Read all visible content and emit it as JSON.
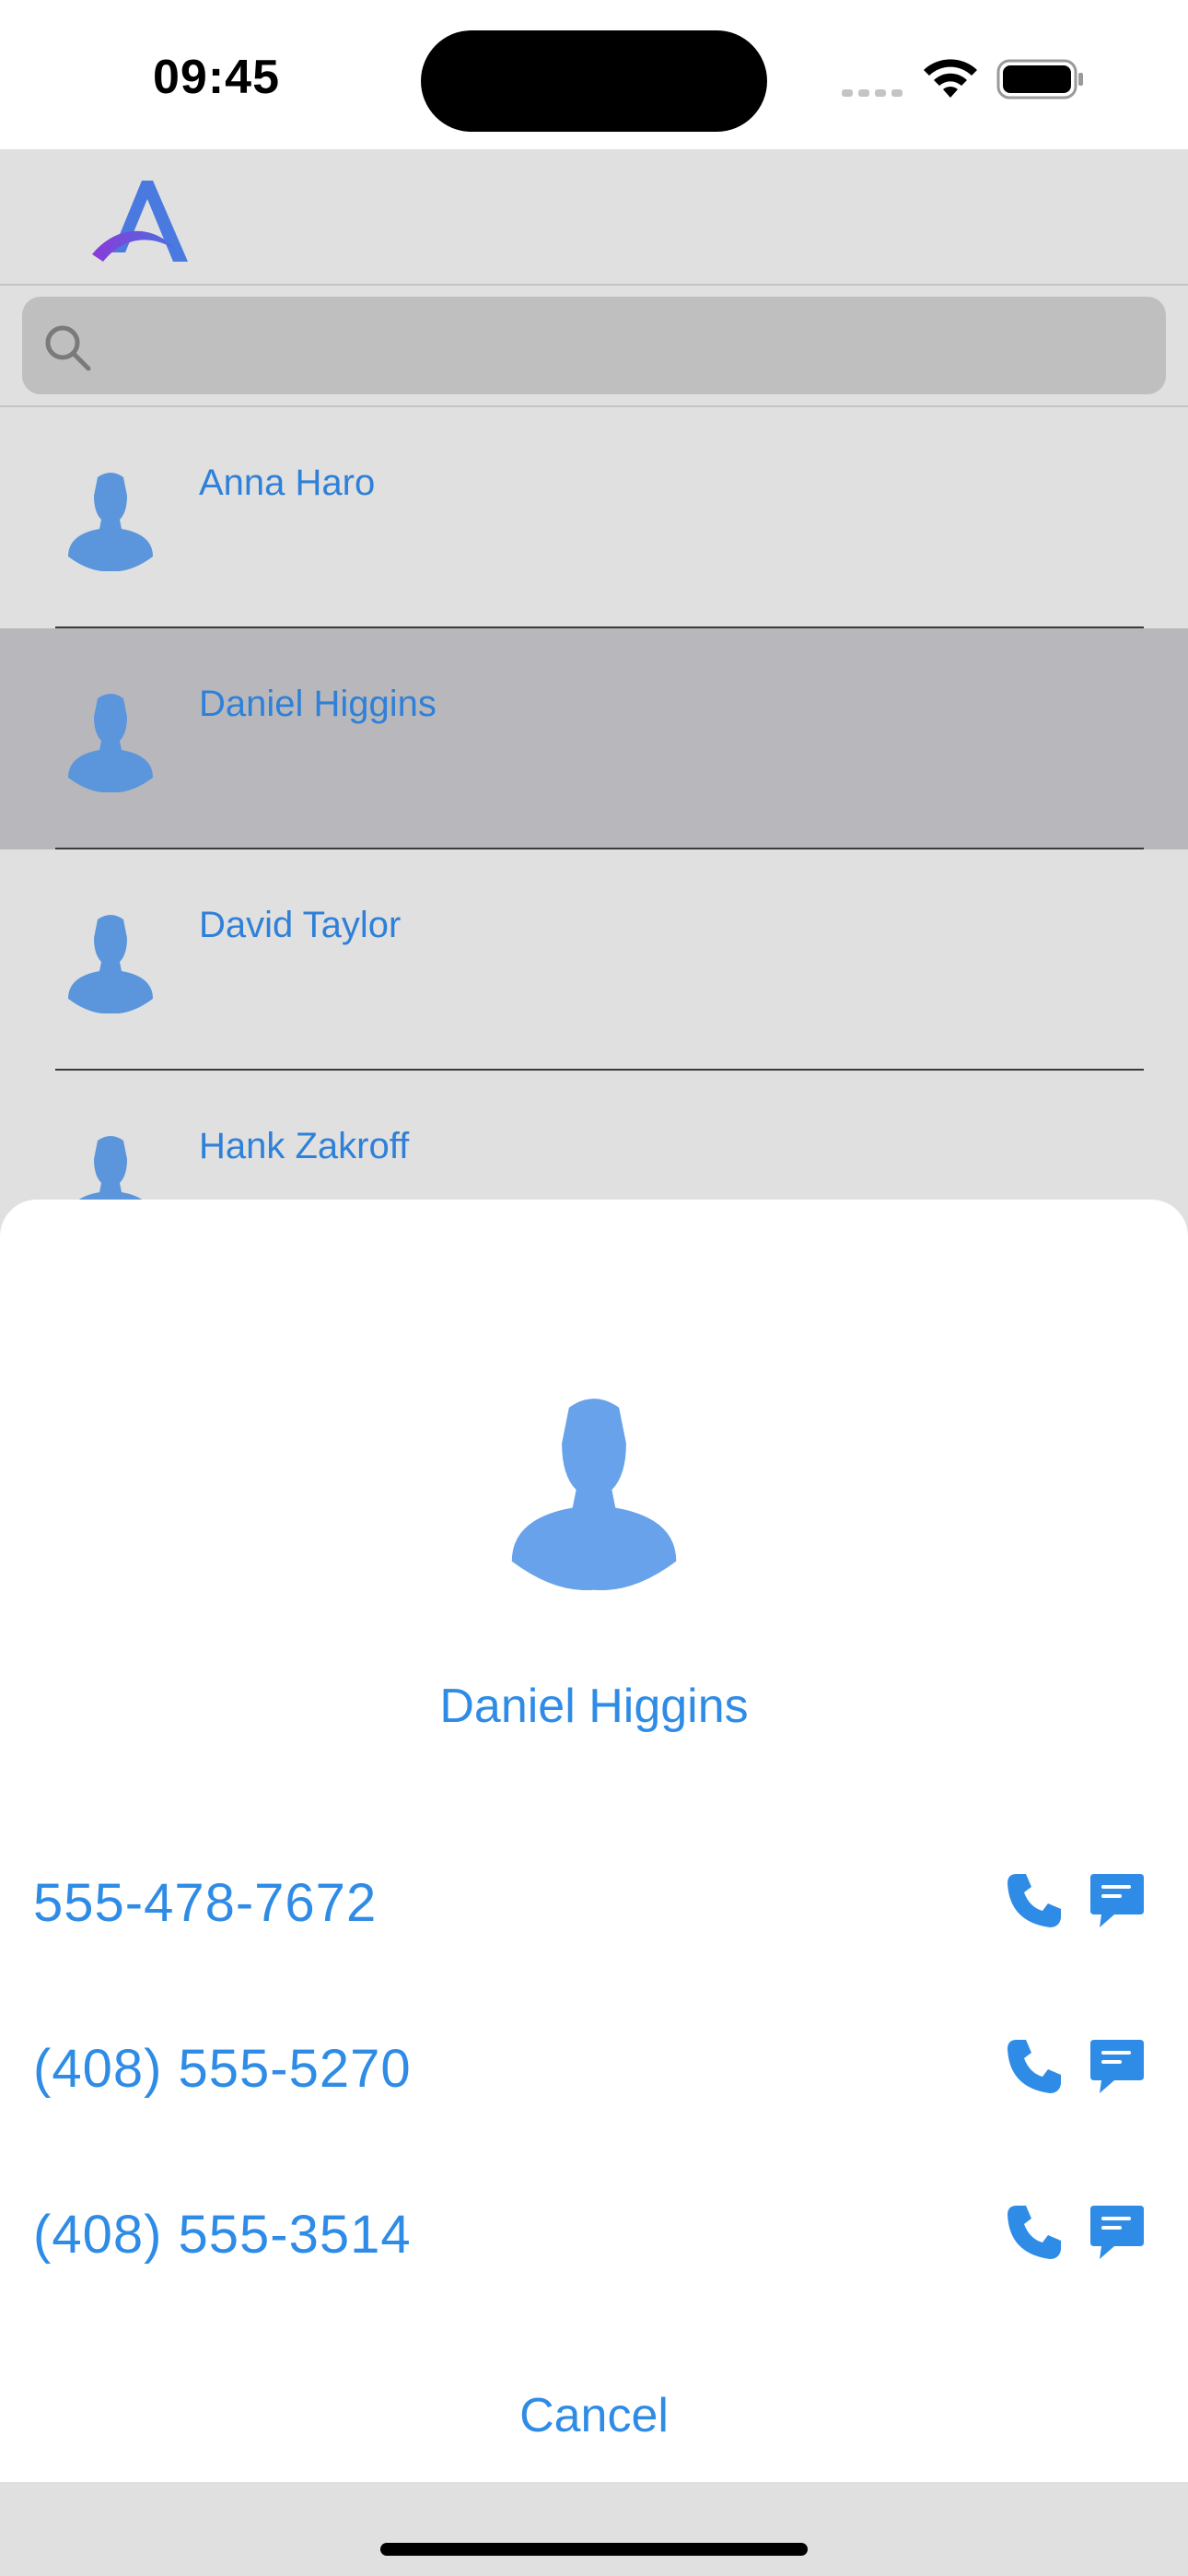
{
  "status_bar": {
    "time": "09:45",
    "icons": [
      "signal-icon",
      "wifi-icon",
      "battery-icon"
    ]
  },
  "app_header": {
    "logo": "app-logo-a"
  },
  "search": {
    "placeholder": "",
    "value": "",
    "icon": "search-icon"
  },
  "contacts": [
    {
      "name": "Anna Haro",
      "selected": false
    },
    {
      "name": "Daniel Higgins",
      "selected": true
    },
    {
      "name": "David Taylor",
      "selected": false
    },
    {
      "name": "Hank Zakroff",
      "selected": false
    }
  ],
  "sheet": {
    "contact_name": "Daniel Higgins",
    "phones": [
      {
        "number": "555-478-7672"
      },
      {
        "number": "(408) 555-5270"
      },
      {
        "number": "(408) 555-3514"
      }
    ],
    "cancel_label": "Cancel"
  },
  "colors": {
    "accent": "#2f8ce6",
    "avatar": "#5b96dc",
    "selected_row": "#b8b8bc",
    "background": "#e0e0e0"
  }
}
